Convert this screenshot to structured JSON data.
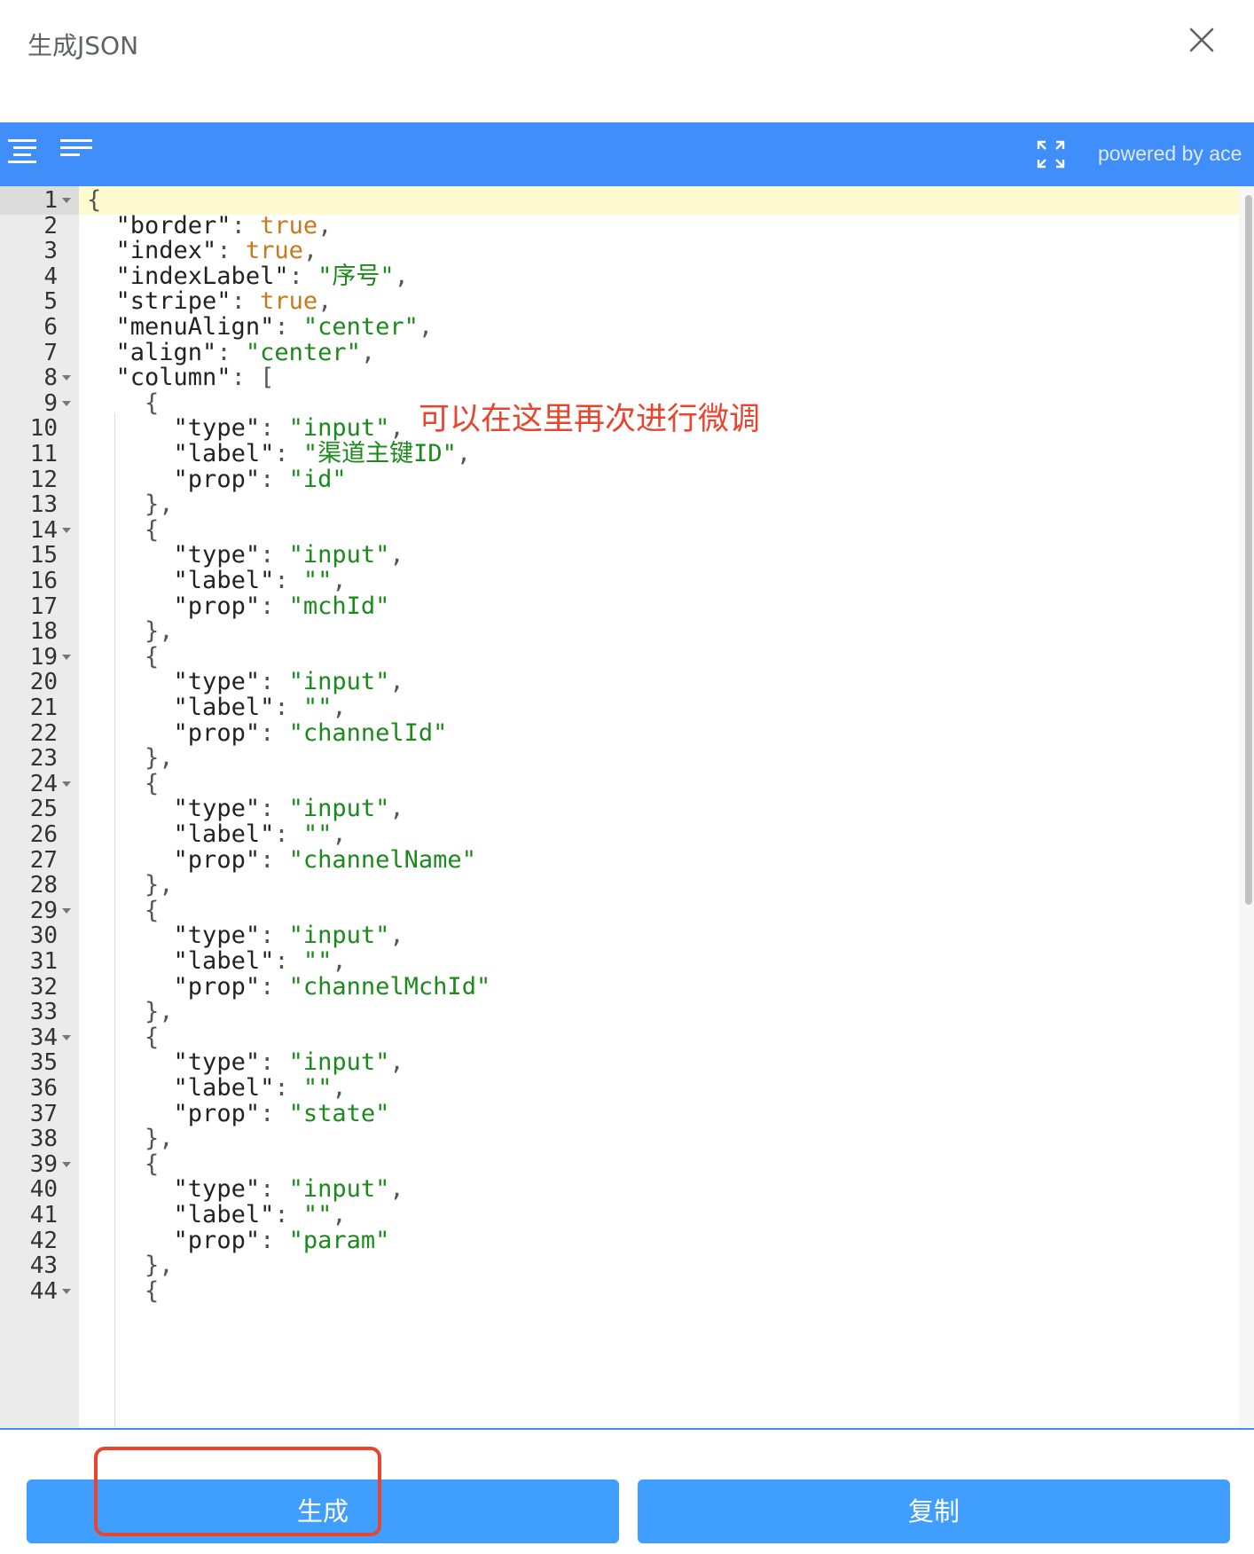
{
  "dialog": {
    "title": "生成JSON",
    "close_icon": "close-icon"
  },
  "toolbar": {
    "format_icon": "format-indent-icon",
    "compact_icon": "compact-lines-icon",
    "fullscreen_icon": "fullscreen-icon",
    "powered_by": "powered by ace"
  },
  "colors": {
    "toolbar_blue": "#3f8ef9",
    "button_blue": "#409eff",
    "annotation_red": "#e8442e",
    "string_green": "#1a8a1a",
    "boolean_orange": "#c9781a"
  },
  "editor": {
    "lines": [
      {
        "n": "1",
        "fold": true,
        "text": "{"
      },
      {
        "n": "2",
        "text": "  \"border\": true,"
      },
      {
        "n": "3",
        "text": "  \"index\": true,"
      },
      {
        "n": "4",
        "text": "  \"indexLabel\": \"序号\","
      },
      {
        "n": "5",
        "text": "  \"stripe\": true,"
      },
      {
        "n": "6",
        "text": "  \"menuAlign\": \"center\","
      },
      {
        "n": "7",
        "text": "  \"align\": \"center\","
      },
      {
        "n": "8",
        "fold": true,
        "text": "  \"column\": ["
      },
      {
        "n": "9",
        "fold": true,
        "text": "    {"
      },
      {
        "n": "10",
        "text": "      \"type\": \"input\","
      },
      {
        "n": "11",
        "text": "      \"label\": \"渠道主键ID\","
      },
      {
        "n": "12",
        "text": "      \"prop\": \"id\""
      },
      {
        "n": "13",
        "text": "    },"
      },
      {
        "n": "14",
        "fold": true,
        "text": "    {"
      },
      {
        "n": "15",
        "text": "      \"type\": \"input\","
      },
      {
        "n": "16",
        "text": "      \"label\": \"\","
      },
      {
        "n": "17",
        "text": "      \"prop\": \"mchId\""
      },
      {
        "n": "18",
        "text": "    },"
      },
      {
        "n": "19",
        "fold": true,
        "text": "    {"
      },
      {
        "n": "20",
        "text": "      \"type\": \"input\","
      },
      {
        "n": "21",
        "text": "      \"label\": \"\","
      },
      {
        "n": "22",
        "text": "      \"prop\": \"channelId\""
      },
      {
        "n": "23",
        "text": "    },"
      },
      {
        "n": "24",
        "fold": true,
        "text": "    {"
      },
      {
        "n": "25",
        "text": "      \"type\": \"input\","
      },
      {
        "n": "26",
        "text": "      \"label\": \"\","
      },
      {
        "n": "27",
        "text": "      \"prop\": \"channelName\""
      },
      {
        "n": "28",
        "text": "    },"
      },
      {
        "n": "29",
        "fold": true,
        "text": "    {"
      },
      {
        "n": "30",
        "text": "      \"type\": \"input\","
      },
      {
        "n": "31",
        "text": "      \"label\": \"\","
      },
      {
        "n": "32",
        "text": "      \"prop\": \"channelMchId\""
      },
      {
        "n": "33",
        "text": "    },"
      },
      {
        "n": "34",
        "fold": true,
        "text": "    {"
      },
      {
        "n": "35",
        "text": "      \"type\": \"input\","
      },
      {
        "n": "36",
        "text": "      \"label\": \"\","
      },
      {
        "n": "37",
        "text": "      \"prop\": \"state\""
      },
      {
        "n": "38",
        "text": "    },"
      },
      {
        "n": "39",
        "fold": true,
        "text": "    {"
      },
      {
        "n": "40",
        "text": "      \"type\": \"input\","
      },
      {
        "n": "41",
        "text": "      \"label\": \"\","
      },
      {
        "n": "42",
        "text": "      \"prop\": \"param\""
      },
      {
        "n": "43",
        "text": "    },"
      },
      {
        "n": "44",
        "fold": true,
        "text": "    {"
      }
    ]
  },
  "annotation": {
    "text": "可以在这里再次进行微调"
  },
  "footer": {
    "generate_label": "生成",
    "copy_label": "复制"
  }
}
